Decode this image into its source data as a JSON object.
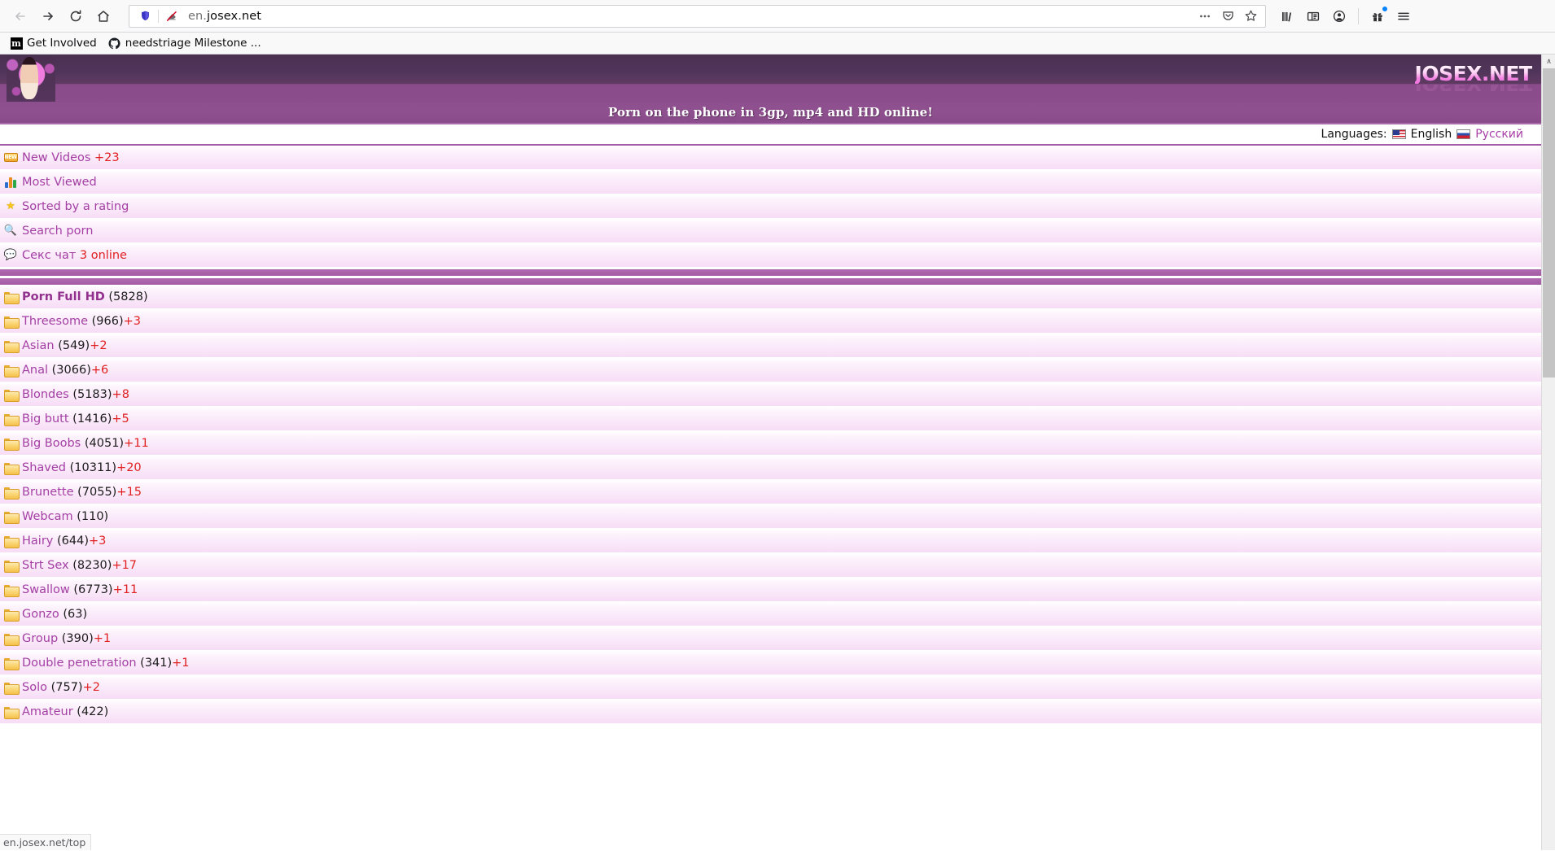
{
  "browser": {
    "back_tooltip": "Back",
    "forward_tooltip": "Forward",
    "reload_tooltip": "Reload",
    "home_tooltip": "Home",
    "url_prefix": "en.",
    "url_rest": "josex.net",
    "url_full": "en.josex.net",
    "shield_icon": "tracking-protection-shield-icon",
    "insecure_icon": "connection-not-secure-icon",
    "page_actions_icon": "ellipsis-icon",
    "pocket_icon": "pocket-save-icon",
    "bookmark_icon": "bookmark-star-icon",
    "library_icon": "library-icon",
    "sidebar_icon": "sidebar-icon",
    "account_icon": "account-icon",
    "gift_icon": "gift-icon",
    "menu_icon": "hamburger-menu-icon",
    "bookmarks": [
      {
        "label": "Get Involved",
        "favicon": "mozilla-m-icon"
      },
      {
        "label": "needstriage Milestone ...",
        "favicon": "github-icon"
      }
    ],
    "status_text": "en.josex.net/top",
    "scrollbar_up_glyph": "∧"
  },
  "site": {
    "logo_text": "JOSEX.NET",
    "tagline": "Porn on the phone in 3gp, mp4 and HD online!",
    "languages": {
      "label": "Languages:",
      "options": [
        {
          "name": "English",
          "flag": "us-flag-icon",
          "active": true
        },
        {
          "name": "Русский",
          "flag": "ru-flag-icon",
          "active": false
        }
      ]
    },
    "nav": [
      {
        "label": "New Videos",
        "badge": "+23",
        "icon": "new-badge-icon",
        "icon_text": "NEW"
      },
      {
        "label": "Most Viewed",
        "badge": "",
        "icon": "bar-chart-icon",
        "icon_text": ""
      },
      {
        "label": "Sorted by a rating",
        "badge": "",
        "icon": "star-icon",
        "icon_text": "★"
      },
      {
        "label": "Search porn",
        "badge": "",
        "icon": "magnifier-icon",
        "icon_text": "🔍"
      },
      {
        "label": "Секс чат",
        "badge": "3 online",
        "icon": "chat-bubble-icon",
        "icon_text": "💬"
      }
    ],
    "categories": [
      {
        "name": "Porn Full HD",
        "count": "(5828)",
        "plus": "",
        "bold": true
      },
      {
        "name": "Threesome",
        "count": "(966)",
        "plus": "+3",
        "bold": false
      },
      {
        "name": "Asian",
        "count": "(549)",
        "plus": "+2",
        "bold": false
      },
      {
        "name": "Anal",
        "count": "(3066)",
        "plus": "+6",
        "bold": false
      },
      {
        "name": "Blondes",
        "count": "(5183)",
        "plus": "+8",
        "bold": false
      },
      {
        "name": "Big butt",
        "count": "(1416)",
        "plus": "+5",
        "bold": false
      },
      {
        "name": "Big Boobs",
        "count": "(4051)",
        "plus": "+11",
        "bold": false
      },
      {
        "name": "Shaved",
        "count": "(10311)",
        "plus": "+20",
        "bold": false
      },
      {
        "name": "Brunette",
        "count": "(7055)",
        "plus": "+15",
        "bold": false
      },
      {
        "name": "Webcam",
        "count": "(110)",
        "plus": "",
        "bold": false
      },
      {
        "name": "Hairy",
        "count": "(644)",
        "plus": "+3",
        "bold": false
      },
      {
        "name": "Strt Sex",
        "count": "(8230)",
        "plus": "+17",
        "bold": false
      },
      {
        "name": "Swallow",
        "count": "(6773)",
        "plus": "+11",
        "bold": false
      },
      {
        "name": "Gonzo",
        "count": "(63)",
        "plus": "",
        "bold": false
      },
      {
        "name": "Group",
        "count": "(390)",
        "plus": "+1",
        "bold": false
      },
      {
        "name": "Double penetration",
        "count": "(341)",
        "plus": "+1",
        "bold": false
      },
      {
        "name": "Solo",
        "count": "(757)",
        "plus": "+2",
        "bold": false
      },
      {
        "name": "Amateur",
        "count": "(422)",
        "plus": "",
        "bold": false
      }
    ]
  },
  "colors": {
    "link": "#a43fa4",
    "plus": "#e02020",
    "header_dark": "#4a3050",
    "header_light": "#8c4d8c",
    "row_pink": "#f8e0f7"
  }
}
